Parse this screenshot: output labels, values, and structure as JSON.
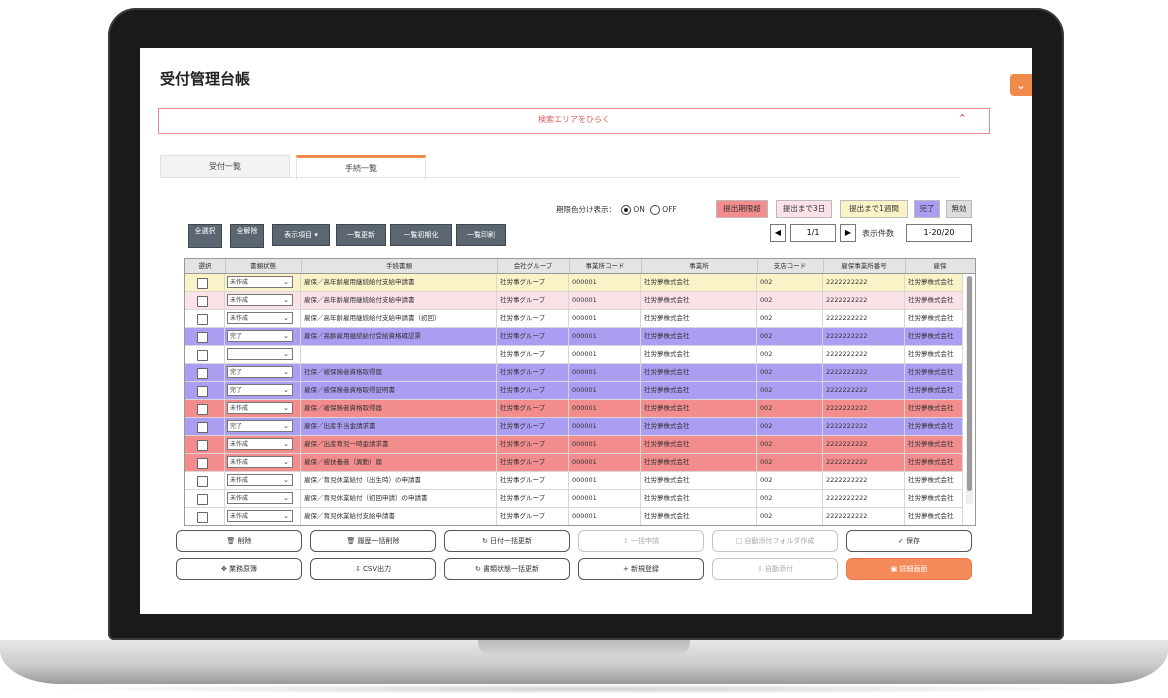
{
  "page_title": "受付管理台帳",
  "search_toggle": {
    "label": "検索エリアをひらく"
  },
  "tabs": [
    {
      "label": "受付一覧",
      "active": false
    },
    {
      "label": "手続一覧",
      "active": true
    }
  ],
  "color_toggle": {
    "label": "期限色分け表示：",
    "on": "ON",
    "off": "OFF",
    "selected": "ON"
  },
  "legend": [
    {
      "label": "提出期限超",
      "color": "#f38c8c"
    },
    {
      "label": "提出まで3日",
      "color": "#fbe2e6"
    },
    {
      "label": "提出まで1週間",
      "color": "#fbf3c8"
    },
    {
      "label": "完了",
      "color": "#a99ef2"
    },
    {
      "label": "無効",
      "color": "#dedede"
    }
  ],
  "toolbar": {
    "select_all": "全選択",
    "deselect_all": "全解除",
    "display_items": "表示項目",
    "refresh": "一覧更新",
    "reset": "一覧初期化",
    "print": "一覧印刷"
  },
  "pager": {
    "page": "1/1",
    "count_label": "表示件数",
    "count": "1-20/20"
  },
  "table": {
    "columns": [
      "選択",
      "書類状態",
      "手続書類",
      "会社グループ",
      "事業所コード",
      "事業所",
      "支店コード",
      "雇保事業所番号",
      "雇保"
    ],
    "rows": [
      {
        "color": "#fbf3c8",
        "status": "未作成",
        "doc": "雇保／高年齢雇用継続給付支給申請書",
        "group": "社労事グループ",
        "office_code": "000001",
        "office": "社労夢株式会社",
        "branch": "002",
        "number": "2222222222",
        "extra": "社労夢株式会社"
      },
      {
        "color": "#fbe2e6",
        "status": "未作成",
        "doc": "雇保／高年齢雇用継続給付支給申請書",
        "group": "社労事グループ",
        "office_code": "000001",
        "office": "社労夢株式会社",
        "branch": "002",
        "number": "2222222222",
        "extra": "社労夢株式会社"
      },
      {
        "color": "#ffffff",
        "status": "未作成",
        "doc": "雇保／高年齢雇用継続給付支給申請書（初回）",
        "group": "社労事グループ",
        "office_code": "000001",
        "office": "社労夢株式会社",
        "branch": "002",
        "number": "2222222222",
        "extra": "社労夢株式会社"
      },
      {
        "color": "#a99ef2",
        "status": "完了",
        "doc": "雇保／高齢雇用継続給付受給資格確認票",
        "group": "社労事グループ",
        "office_code": "000001",
        "office": "社労夢株式会社",
        "branch": "002",
        "number": "2222222222",
        "extra": "社労夢株式会社"
      },
      {
        "color": "#ffffff",
        "status": "",
        "doc": "",
        "group": "社労事グループ",
        "office_code": "000001",
        "office": "社労夢株式会社",
        "branch": "002",
        "number": "2222222222",
        "extra": "社労夢株式会社"
      },
      {
        "color": "#a99ef2",
        "status": "完了",
        "doc": "社保／被保険者資格取得届",
        "group": "社労事グループ",
        "office_code": "000001",
        "office": "社労夢株式会社",
        "branch": "002",
        "number": "2222222222",
        "extra": "社労夢株式会社"
      },
      {
        "color": "#a99ef2",
        "status": "完了",
        "doc": "雇保／被保険者資格取得証明書",
        "group": "社労事グループ",
        "office_code": "000001",
        "office": "社労夢株式会社",
        "branch": "002",
        "number": "2222222222",
        "extra": "社労夢株式会社"
      },
      {
        "color": "#f38c8c",
        "status": "未作成",
        "doc": "雇保／被保険者資格取得届",
        "group": "社労事グループ",
        "office_code": "000001",
        "office": "社労夢株式会社",
        "branch": "002",
        "number": "2222222222",
        "extra": "社労夢株式会社"
      },
      {
        "color": "#a99ef2",
        "status": "完了",
        "doc": "雇保／出産手当金請求書",
        "group": "社労事グループ",
        "office_code": "000001",
        "office": "社労夢株式会社",
        "branch": "002",
        "number": "2222222222",
        "extra": "社労夢株式会社"
      },
      {
        "color": "#f38c8c",
        "status": "未作成",
        "doc": "雇保／出産育児一時金請求書",
        "group": "社労事グループ",
        "office_code": "000001",
        "office": "社労夢株式会社",
        "branch": "002",
        "number": "2222222222",
        "extra": "社労夢株式会社"
      },
      {
        "color": "#f38c8c",
        "status": "未作成",
        "doc": "雇保／被扶養者（異動）届",
        "group": "社労事グループ",
        "office_code": "000001",
        "office": "社労夢株式会社",
        "branch": "002",
        "number": "2222222222",
        "extra": "社労夢株式会社"
      },
      {
        "color": "#ffffff",
        "status": "未作成",
        "doc": "雇保／育児休業給付（出生時）の申請書",
        "group": "社労事グループ",
        "office_code": "000001",
        "office": "社労夢株式会社",
        "branch": "002",
        "number": "2222222222",
        "extra": "社労夢株式会社"
      },
      {
        "color": "#ffffff",
        "status": "未作成",
        "doc": "雇保／育児休業給付（初回申請）の申請書",
        "group": "社労事グループ",
        "office_code": "000001",
        "office": "社労夢株式会社",
        "branch": "002",
        "number": "2222222222",
        "extra": "社労夢株式会社"
      },
      {
        "color": "#ffffff",
        "status": "未作成",
        "doc": "雇保／育児休業給付支給申請書",
        "group": "社労事グループ",
        "office_code": "000001",
        "office": "社労夢株式会社",
        "branch": "002",
        "number": "2222222222",
        "extra": "社労夢株式会社"
      }
    ]
  },
  "actions": {
    "delete": "削除",
    "history_delete": "履歴一括削除",
    "date_update": "日付一括更新",
    "bulk_apply": "一括申請",
    "auto_folder": "自動添付フォルダ作成",
    "save": "保存",
    "business_flow": "業務原簿",
    "csv": "CSV出力",
    "status_update": "書類状態一括更新",
    "new_register": "新規登録",
    "auto_attach": "自動添付",
    "detail": "詳細画面"
  }
}
